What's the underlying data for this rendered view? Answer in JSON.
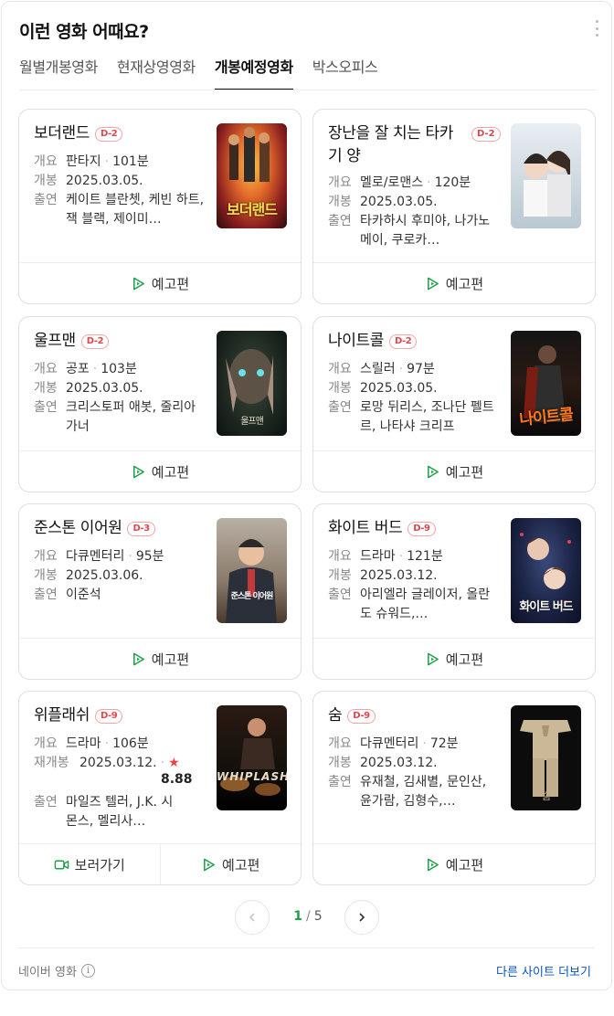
{
  "header": {
    "title": "이런 영화 어때요?",
    "tabs": [
      "월별개봉영화",
      "현재상영영화",
      "개봉예정영화",
      "박스오피스"
    ],
    "active_tab": "개봉예정영화"
  },
  "labels": {
    "genre_key": "개요",
    "release_key": "개봉",
    "rerelease_key": "재개봉",
    "cast_key": "출연",
    "trailer": "예고편",
    "watch": "보러가기"
  },
  "movies": [
    {
      "title": "보더랜드",
      "dday": "D-2",
      "genre": "판타지",
      "runtime": "101분",
      "release": "2025.03.05.",
      "cast": "케이트 블란쳇, 케빈 하트, 잭 블랙, 제이미…",
      "poster_text": "보더랜드"
    },
    {
      "title": "장난을 잘 치는 타카기 양",
      "dday": "D-2",
      "genre": "멜로/로맨스",
      "runtime": "120분",
      "release": "2025.03.05.",
      "cast": "타카하시 후미야, 나가노 메이, 쿠로카…",
      "poster_text": ""
    },
    {
      "title": "울프맨",
      "dday": "D-2",
      "genre": "공포",
      "runtime": "103분",
      "release": "2025.03.05.",
      "cast": "크리스토퍼 애봇, 줄리아 가너",
      "poster_text": "울프맨"
    },
    {
      "title": "나이트콜",
      "dday": "D-2",
      "genre": "스릴러",
      "runtime": "97분",
      "release": "2025.03.05.",
      "cast": "로망 뒤리스, 조나단 펠트르, 나타샤 크리프",
      "poster_text": "나이트콜"
    },
    {
      "title": "준스톤 이어원",
      "dday": "D-3",
      "genre": "다큐멘터리",
      "runtime": "95분",
      "release": "2025.03.06.",
      "cast": "이준석",
      "poster_text": "준스톤 이어원"
    },
    {
      "title": "화이트 버드",
      "dday": "D-9",
      "genre": "드라마",
      "runtime": "121분",
      "release": "2025.03.12.",
      "cast": "아리엘라 글레이저, 올란도 슈워드,…",
      "poster_text": "화이트 버드"
    },
    {
      "title": "위플래쉬",
      "dday": "D-9",
      "genre": "드라마",
      "runtime": "106분",
      "release": "2025.03.12.",
      "rating": "8.88",
      "cast": "마일즈 텔러, J.K. 시몬스, 멜리사…",
      "poster_text": "WHIPLASH"
    },
    {
      "title": "숨",
      "dday": "D-9",
      "genre": "다큐멘터리",
      "runtime": "72분",
      "release": "2025.03.12.",
      "cast": "유재철, 김새별, 문인산, 윤가람, 김형수,…",
      "poster_text": "숨"
    }
  ],
  "pagination": {
    "current": "1",
    "total": "5",
    "separator": "/"
  },
  "footer": {
    "source": "네이버 영화",
    "info_icon": "i",
    "more": "다른 사이트 더보기"
  },
  "colors": {
    "accent_green": "#1ea04a",
    "dday_red": "#e0474c",
    "link_blue": "#0a53be"
  },
  "icons": [
    "more-vertical-icon",
    "play-icon",
    "video-icon",
    "chevron-left-icon",
    "chevron-right-icon",
    "info-icon",
    "star-icon"
  ]
}
